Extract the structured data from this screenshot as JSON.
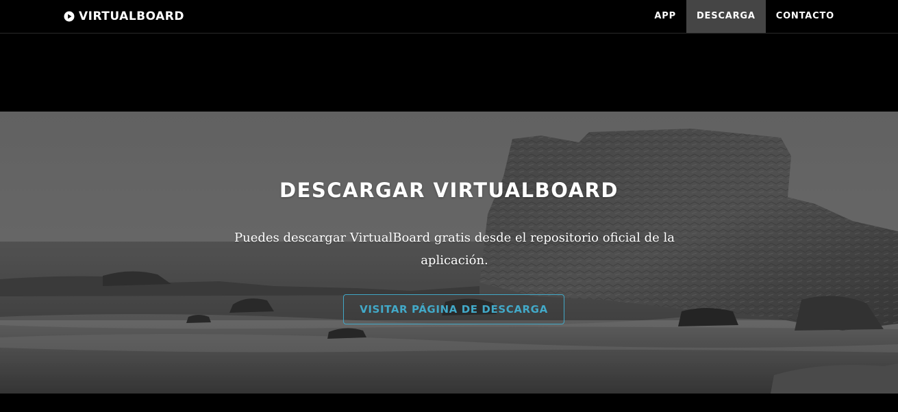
{
  "navbar": {
    "brand": "VIRTUALBOARD",
    "brand_icon": "play-circle-icon",
    "links": [
      {
        "label": "APP",
        "active": false
      },
      {
        "label": "DESCARGA",
        "active": true
      },
      {
        "label": "CONTACTO",
        "active": false
      }
    ]
  },
  "hero": {
    "title": "DESCARGAR VIRTUALBOARD",
    "text": "Puedes descargar VirtualBoard gratis desde el repositorio oficial de la aplicación.",
    "button_label": "VISITAR PÁGINA DE DESCARGA",
    "background": "grayscale-coastal-rock-photo"
  },
  "colors": {
    "navbar_bg": "#000000",
    "active_link_bg": "#454545",
    "accent": "#42a9c8",
    "text": "#ffffff"
  }
}
